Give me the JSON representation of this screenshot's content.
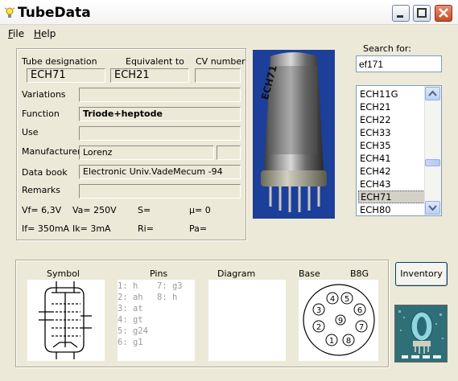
{
  "window": {
    "title": "TubeData"
  },
  "menu": [
    {
      "key": "F",
      "rest": "ile"
    },
    {
      "key": "H",
      "rest": "elp"
    }
  ],
  "header": {
    "tube_designation_label": "Tube designation",
    "equivalent_label": "Equivalent to",
    "cv_label": "CV number",
    "tube_designation": "ECH71",
    "equivalent": "ECH21",
    "cv_number": ""
  },
  "fields": {
    "variations_label": "Variations",
    "variations": "",
    "function_label": "Function",
    "function": "Triode+heptode",
    "use_label": "Use",
    "use": "",
    "manufacturer_label": "Manufacturer",
    "manufacturer": "Lorenz",
    "manufacturer_extra": "",
    "databook_label": "Data book",
    "databook": "Electronic Univ.VadeMecum -94",
    "remarks_label": "Remarks",
    "remarks": ""
  },
  "params": {
    "vf": "Vf= 6,3V",
    "va": "Va= 250V",
    "s": "S=",
    "mu": "µ=    0",
    "if": "If= 350mA",
    "ik": "Ik=   3mA",
    "ri": "Ri=",
    "pa": "Pa="
  },
  "search": {
    "label": "Search for:",
    "value": "ef171"
  },
  "tube_list": {
    "items": [
      "ECH11G",
      "ECH21",
      "ECH22",
      "ECH33",
      "ECH35",
      "ECH41",
      "ECH42",
      "ECH43",
      "ECH71",
      "ECH80"
    ],
    "selected": "ECH71"
  },
  "photo": {
    "label": "ECH71"
  },
  "bottom": {
    "symbol_label": "Symbol",
    "pins_label": "Pins",
    "diagram_label": "Diagram",
    "base_label": "Base",
    "base_type": "B8G",
    "pins_col1": [
      "1: h",
      "2: ah",
      "3: at",
      "4: gt",
      "5: g24",
      "6: g1"
    ],
    "pins_col2": [
      "7: g3",
      "8: h"
    ],
    "base_pins": [
      "1",
      "2",
      "3",
      "4",
      "5",
      "6",
      "7",
      "8",
      "9"
    ]
  },
  "buttons": {
    "inventory": "Inventory"
  },
  "colors": {
    "titlebar": "#ffffff",
    "window_bg": "#ece9d8",
    "close_button": "#c84a25",
    "photo_bg": "#1c3f9a",
    "selection": "#d4d0c8"
  }
}
